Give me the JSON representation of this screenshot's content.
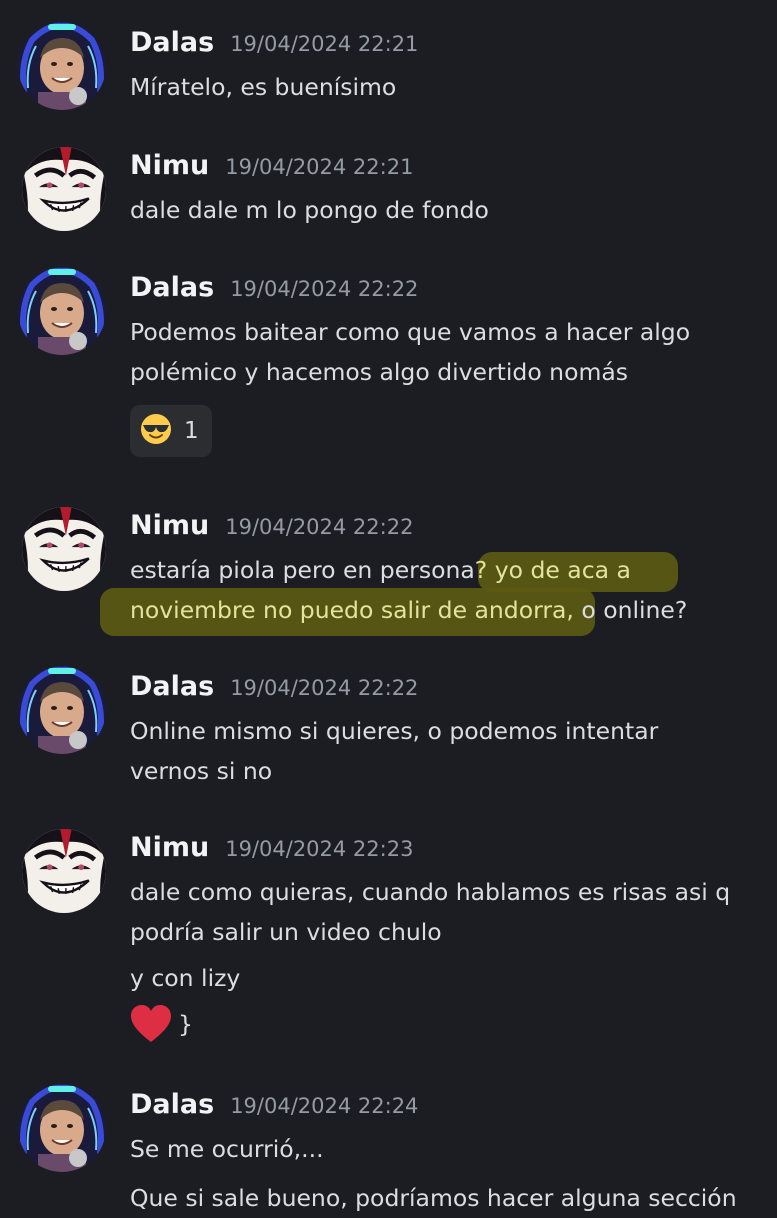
{
  "users": {
    "dalas": "Dalas",
    "nimu": "Nimu"
  },
  "messages": [
    {
      "author": "Dalas",
      "timestamp": "19/04/2024 22:21",
      "lines": [
        "Míratelo, es buenísimo"
      ]
    },
    {
      "author": "Nimu",
      "timestamp": "19/04/2024 22:21",
      "lines": [
        "dale dale m lo pongo de fondo"
      ]
    },
    {
      "author": "Dalas",
      "timestamp": "19/04/2024 22:22",
      "lines": [
        "Podemos baitear como que vamos a hacer algo",
        "polémico y hacemos algo divertido nomás"
      ],
      "reaction": {
        "emoji": "sunglasses-emoji",
        "count": "1"
      }
    },
    {
      "author": "Nimu",
      "timestamp": "19/04/2024 22:22",
      "line1_plain": "estaría piola pero en persona",
      "line1_hl": "? yo de aca a",
      "line2_hl": "noviembre no puedo salir de andorra,",
      "line2_plain": " o online?"
    },
    {
      "author": "Dalas",
      "timestamp": "19/04/2024 22:22",
      "lines": [
        "Online mismo si quieres, o podemos intentar",
        "vernos si no"
      ]
    },
    {
      "author": "Nimu",
      "timestamp": "19/04/2024 22:23",
      "lines": [
        "dale como quieras, cuando hablamos es risas asi q",
        "podría salir un video chulo"
      ],
      "followups": [
        "y con lizy"
      ],
      "heart_suffix": "}"
    },
    {
      "author": "Dalas",
      "timestamp": "19/04/2024 22:24",
      "lines": [
        "Se me ocurrió,...",
        "Que si sale bueno, podríamos hacer alguna sección"
      ]
    }
  ],
  "colors": {
    "background": "#1c1d22",
    "highlight": "#5c5a14",
    "reaction_bg": "#2b2d31"
  }
}
